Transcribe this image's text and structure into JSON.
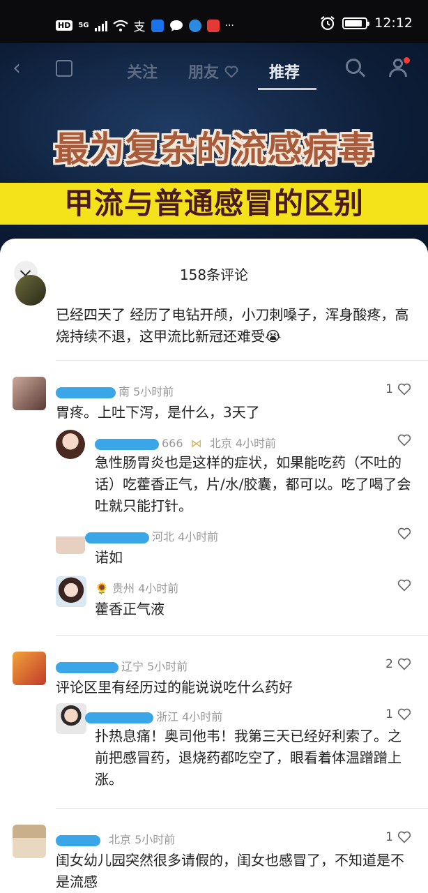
{
  "status_bar": {
    "hd": "HD",
    "network": "5G",
    "pay_glyph": "支",
    "more": "···",
    "time": "12:12",
    "icons": [
      "signal-icon",
      "wifi-icon",
      "alipay-icon",
      "app-icon",
      "chat-icon",
      "browser-icon",
      "app-icon",
      "alarm-icon",
      "battery-icon"
    ]
  },
  "nav": {
    "tabs": [
      "关注",
      "朋友",
      "推荐"
    ],
    "active_tab": "推荐",
    "icons": [
      "back-icon",
      "cast-icon",
      "heart-icon",
      "search-icon",
      "user-icon"
    ]
  },
  "video": {
    "headline_1": "最为复杂的流感病毒",
    "headline_2": "甲流与普通感冒的区别"
  },
  "comments_panel": {
    "title": "158条评论",
    "comments": [
      {
        "text": "已经四天了 经历了电钻开颅，小刀刺嗓子，浑身酸疼，高烧持续不退，这甲流比新冠还难受😭"
      },
      {
        "location_time": "南 5小时前",
        "text": "胃疼。上吐下泻，是什么，3天了",
        "likes": "1",
        "replies": [
          {
            "name_suffix": "666",
            "location_time": "北京 4小时前",
            "text": "急性肠胃炎也是这样的症状，如果能吃药（不吐的话）吃藿香正气，片/水/胶囊，都可以。吃了喝了会吐就只能打针。"
          },
          {
            "location_time": "河北 4小时前",
            "text": "诺如"
          },
          {
            "name_glyph": "🌻",
            "location_time": "贵州 4小时前",
            "text": "藿香正气液"
          }
        ]
      },
      {
        "location_time": "辽宁 5小时前",
        "text": "评论区里有经历过的能说说吃什么药好",
        "likes": "2",
        "replies": [
          {
            "location_time": "浙江 4小时前",
            "text": "扑热息痛！奥司他韦！我第三天已经好利索了。之前把感冒药，退烧药都吃空了，眼看着体温蹭蹭上涨。",
            "likes": "1"
          }
        ]
      },
      {
        "location_time": "北京 5小时前",
        "text": "闺女幼儿园突然很多请假的，闺女也感冒了，不知道是不是流感",
        "likes": "1"
      }
    ]
  },
  "colors": {
    "accent_blue": "#3aa6e8",
    "headline_yellow": "#f4e21a",
    "headline_brown": "#a85a3a"
  }
}
